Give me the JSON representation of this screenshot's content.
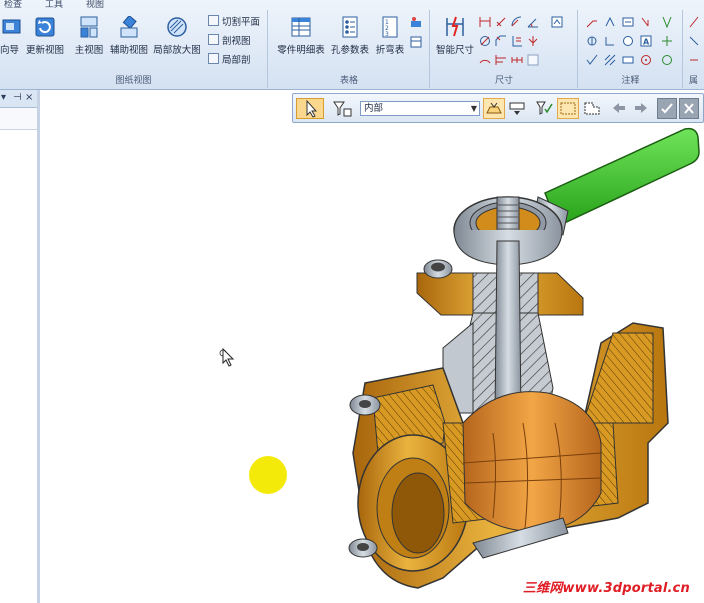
{
  "ribbon": {
    "tabs": [
      "检查",
      "工具",
      "视图"
    ],
    "groups": {
      "drawing_views": {
        "label": "图纸视图",
        "buttons": {
          "view_wizard": "视图向导",
          "update_views": "更新视图",
          "principal_view": "主视图",
          "auxiliary_view": "辅助视图",
          "detail_view": "局部放大图",
          "cutting_plane": "切割平面",
          "section_view": "剖视图",
          "broken_out_section": "局部剖"
        }
      },
      "tables": {
        "label": "表格",
        "buttons": {
          "parts_list": "零件明细表",
          "hole_table": "孔参数表",
          "bend_table": "折弯表"
        }
      },
      "dimension": {
        "label": "尺寸",
        "buttons": {
          "smart_dimension": "智能尺寸"
        }
      },
      "annotation": {
        "label": "注释"
      },
      "extra": {
        "label": "属"
      }
    }
  },
  "left_panel": {
    "pin_icons": [
      "▾",
      "⊣",
      "×"
    ]
  },
  "quickbar": {
    "select_value": "内部",
    "active_color": "#fcd88f"
  },
  "canvas": {
    "watermark": "三维网www.3dportal.cn",
    "highlight_color": "#f4ea0a"
  },
  "colors": {
    "handle_green": "#3ec22c",
    "body_gold": "#d89a22",
    "steel_gray": "#a9b2bd",
    "ball_orange": "#e79236"
  }
}
